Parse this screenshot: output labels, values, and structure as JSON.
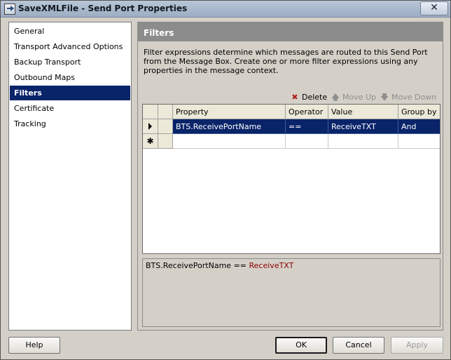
{
  "window": {
    "title": "SaveXMLFile - Send Port Properties",
    "close_glyph": "✕"
  },
  "nav": {
    "items": [
      {
        "label": "General",
        "selected": false
      },
      {
        "label": "Transport Advanced Options",
        "selected": false
      },
      {
        "label": "Backup Transport",
        "selected": false
      },
      {
        "label": "Outbound Maps",
        "selected": false
      },
      {
        "label": "Filters",
        "selected": true
      },
      {
        "label": "Certificate",
        "selected": false
      },
      {
        "label": "Tracking",
        "selected": false
      }
    ]
  },
  "panel": {
    "header": "Filters",
    "description": "Filter expressions determine which messages are routed to this Send Port from the Message Box. Create one or more filter expressions using any properties in the message context."
  },
  "toolbar": {
    "delete_label": "Delete",
    "delete_icon": "✖",
    "move_up_label": "Move Up",
    "move_up_icon": "🡅",
    "move_down_label": "Move Down",
    "move_down_icon": "🡇"
  },
  "grid": {
    "columns": [
      "Property",
      "Operator",
      "Value",
      "Group by"
    ],
    "rows": [
      {
        "property": "BTS.ReceivePortName",
        "operator": "==",
        "value": "ReceiveTXT",
        "group_by": "And"
      }
    ],
    "new_row_glyph": "✱"
  },
  "preview": {
    "property": "BTS.ReceivePortName",
    "operator": "==",
    "value": "ReceiveTXT"
  },
  "buttons": {
    "help": "Help",
    "ok": "OK",
    "cancel": "Cancel",
    "apply": "Apply"
  },
  "colors": {
    "selection": "#0a246a",
    "preview_value": "#8b0000"
  }
}
